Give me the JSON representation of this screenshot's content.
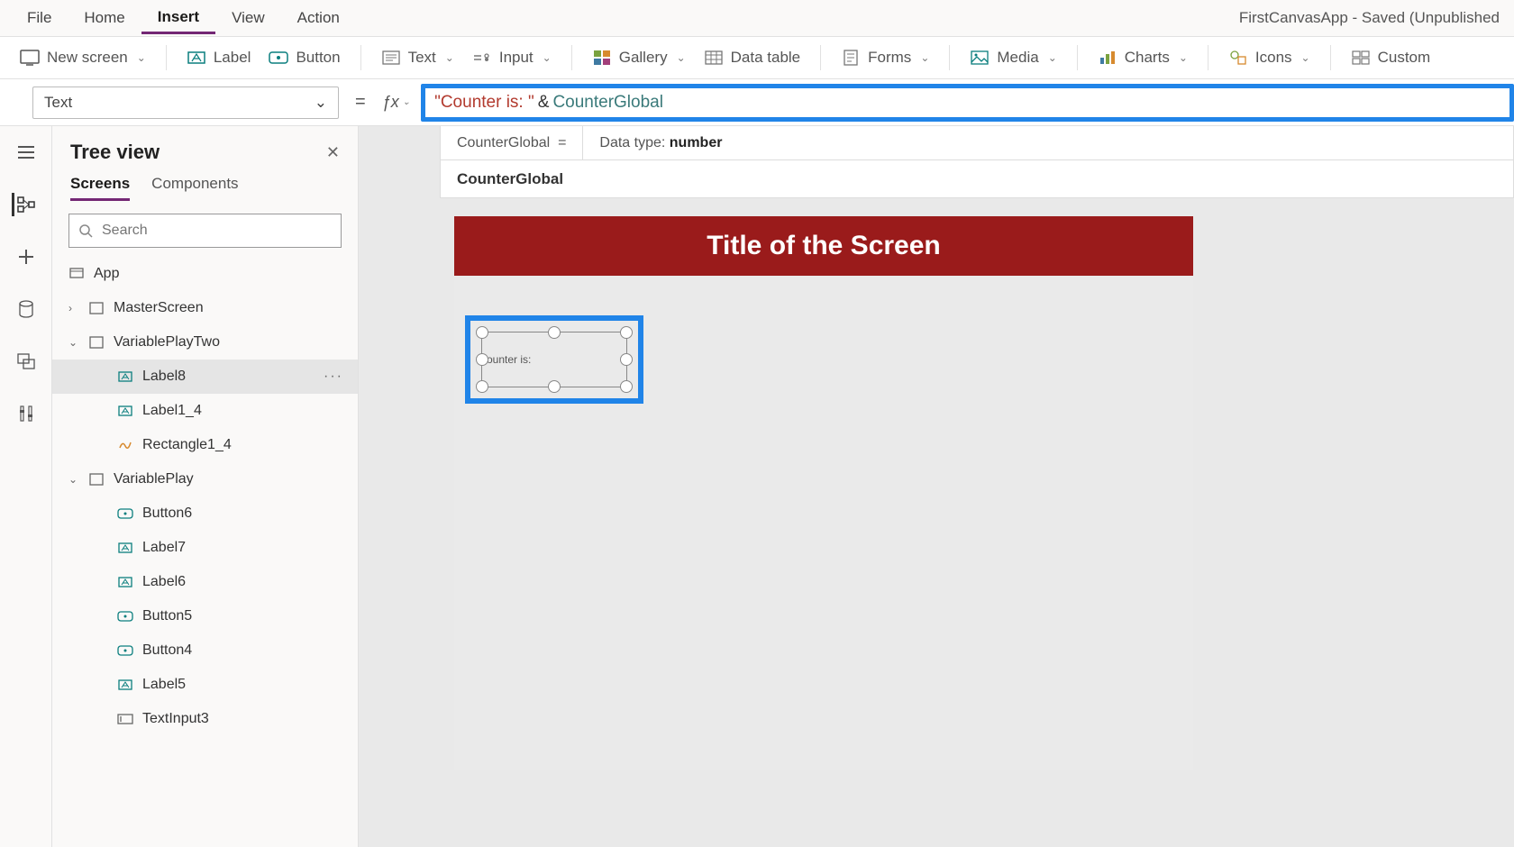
{
  "app_title": "FirstCanvasApp - Saved (Unpublished",
  "menu": {
    "file": "File",
    "home": "Home",
    "insert": "Insert",
    "view": "View",
    "action": "Action",
    "active": "Insert"
  },
  "ribbon": {
    "new_screen": "New screen",
    "label": "Label",
    "button": "Button",
    "text": "Text",
    "input": "Input",
    "gallery": "Gallery",
    "data_table": "Data table",
    "forms": "Forms",
    "media": "Media",
    "charts": "Charts",
    "icons": "Icons",
    "custom": "Custom"
  },
  "property_selector": "Text",
  "formula": {
    "string": "\"Counter is: \"",
    "op": "&",
    "ident": "CounterGlobal"
  },
  "intellisense": {
    "var_expr": "CounterGlobal  =",
    "dtype_label": "Data type: ",
    "dtype_value": "number",
    "suggestion": "CounterGlobal"
  },
  "tree": {
    "title": "Tree view",
    "tab_screens": "Screens",
    "tab_components": "Components",
    "search_placeholder": "Search",
    "items": [
      {
        "name": "App",
        "icon": "app"
      },
      {
        "name": "MasterScreen",
        "icon": "screen",
        "exp": "›"
      },
      {
        "name": "VariablePlayTwo",
        "icon": "screen",
        "exp": "⌄"
      },
      {
        "name": "Label8",
        "icon": "label",
        "indent": 2,
        "selected": true,
        "dots": "···"
      },
      {
        "name": "Label1_4",
        "icon": "label",
        "indent": 2
      },
      {
        "name": "Rectangle1_4",
        "icon": "rect",
        "indent": 2
      },
      {
        "name": "VariablePlay",
        "icon": "screen",
        "exp": "⌄"
      },
      {
        "name": "Button6",
        "icon": "button",
        "indent": 2
      },
      {
        "name": "Label7",
        "icon": "label",
        "indent": 2
      },
      {
        "name": "Label6",
        "icon": "label",
        "indent": 2
      },
      {
        "name": "Button5",
        "icon": "button",
        "indent": 2
      },
      {
        "name": "Button4",
        "icon": "button",
        "indent": 2
      },
      {
        "name": "Label5",
        "icon": "label",
        "indent": 2
      },
      {
        "name": "TextInput3",
        "icon": "textinput",
        "indent": 2
      }
    ]
  },
  "canvas": {
    "title": "Title of the Screen",
    "sel_text": "ounter is:"
  }
}
